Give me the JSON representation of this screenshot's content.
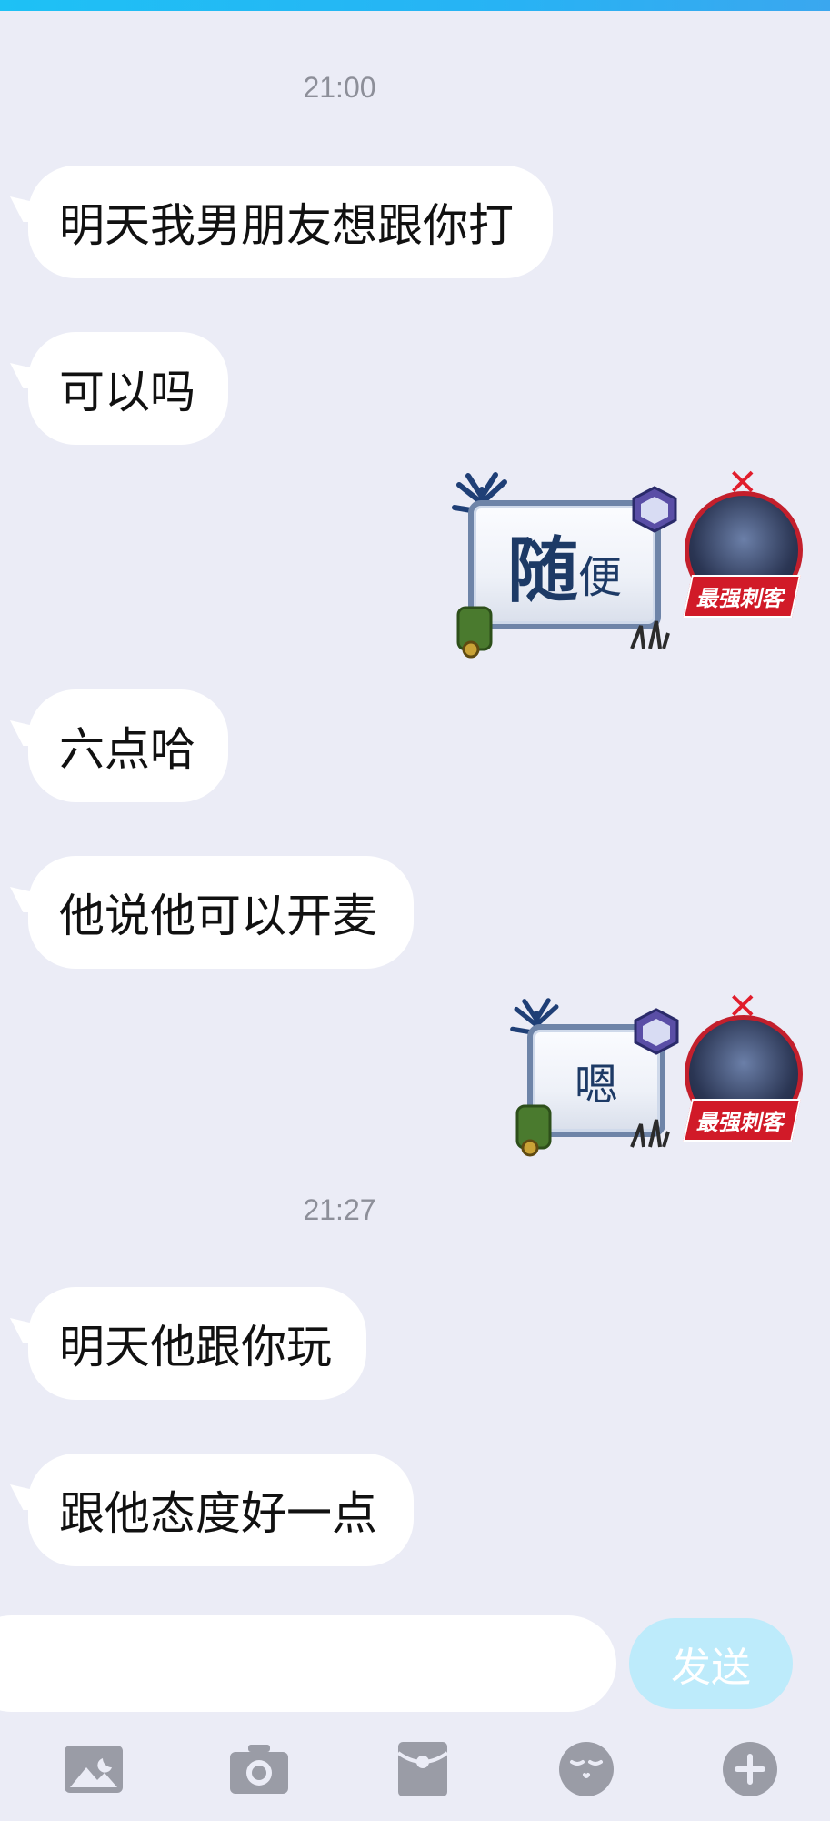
{
  "colors": {
    "background": "#ebecf6",
    "bubble": "#ffffff",
    "accent": "#1ec1f5",
    "send_button": "#bdebfb",
    "icon_gray": "#9a9ca6"
  },
  "timestamps": [
    "21:00",
    "21:27"
  ],
  "messages": [
    {
      "text": "明天我男朋友想跟你打",
      "side": "left"
    },
    {
      "text": "可以吗",
      "side": "left"
    },
    {
      "text": "六点哈",
      "side": "left"
    },
    {
      "text": "他说他可以开麦",
      "side": "left"
    },
    {
      "text": "明天他跟你玩",
      "side": "left"
    },
    {
      "text": "跟他态度好一点",
      "side": "left"
    }
  ],
  "stickers": [
    {
      "main": "随",
      "sub": "便",
      "badge": "最强刺客"
    },
    {
      "main": "嗯",
      "badge": "最强刺客"
    }
  ],
  "composer": {
    "placeholder": "",
    "send_label": "发送"
  },
  "toolbar": [
    "image-icon",
    "camera-icon",
    "red-packet-icon",
    "emoji-icon",
    "plus-icon"
  ]
}
